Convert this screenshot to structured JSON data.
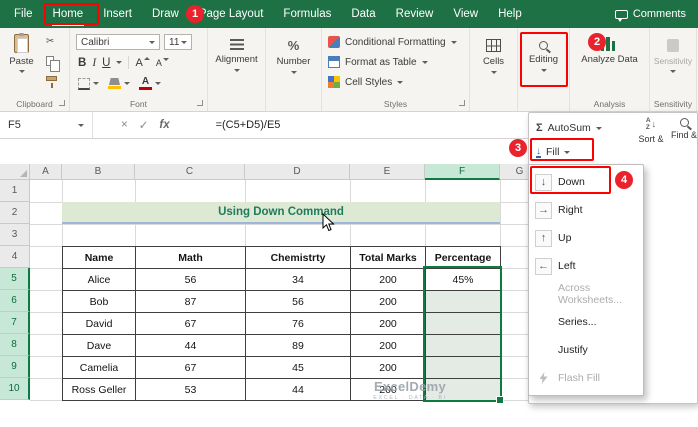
{
  "ribbon_tabs": {
    "items": [
      "File",
      "Home",
      "Insert",
      "Draw",
      "Page Layout",
      "Formulas",
      "Data",
      "Review",
      "View",
      "Help"
    ],
    "comments_label": "Comments"
  },
  "ribbon": {
    "clipboard": {
      "label": "Clipboard",
      "paste": "Paste"
    },
    "font": {
      "label": "Font",
      "family": "Calibri",
      "size": "11",
      "bold": "B",
      "italic": "I",
      "underline": "U",
      "grow": "A",
      "shrink": "A",
      "font_color": "A"
    },
    "alignment": {
      "label": "Alignment"
    },
    "number": {
      "label": "Number"
    },
    "styles": {
      "label": "Styles",
      "conditional_formatting": "Conditional Formatting",
      "format_as_table": "Format as Table",
      "cell_styles": "Cell Styles"
    },
    "cells": {
      "label": "Cells"
    },
    "editing": {
      "label": "Editing"
    },
    "analysis": {
      "label": "Analysis",
      "analyze_data": "Analyze Data"
    },
    "sensitivity": {
      "label": "Sensitivity",
      "button": "Sensitivity"
    }
  },
  "formula_bar": {
    "name_box": "F5",
    "cancel": "×",
    "enter": "✓",
    "fx": "fx",
    "formula": "=(C5+D5)/E5"
  },
  "editing_flyout": {
    "autosum_label": "AutoSum",
    "fill_label": "Fill",
    "sort_label": "Sort &",
    "find_label": "Find &",
    "menu": [
      {
        "label": "Down"
      },
      {
        "label": "Right"
      },
      {
        "label": "Up"
      },
      {
        "label": "Left"
      },
      {
        "label": "Across Worksheets..."
      },
      {
        "label": "Series..."
      },
      {
        "label": "Justify"
      },
      {
        "label": "Flash Fill"
      }
    ]
  },
  "icons": {
    "sigma": "Σ",
    "arrow_down": "↓",
    "arrow_right": "→",
    "arrow_up": "↑",
    "arrow_left": "←",
    "scissors": "✂",
    "percent": "%",
    "sort_a": "A",
    "sort_z": "Z"
  },
  "annotations": {
    "step1": "1",
    "step2": "2",
    "step3": "3",
    "step4": "4"
  },
  "sheet": {
    "col_headers": [
      "A",
      "B",
      "C",
      "D",
      "E",
      "F",
      "G"
    ],
    "row_headers": [
      "1",
      "2",
      "3",
      "4",
      "5",
      "6",
      "7",
      "8",
      "9",
      "10"
    ],
    "title": "Using Down Command",
    "table": {
      "headers": [
        "Name",
        "Math",
        "Chemistrty",
        "Total Marks",
        "Percentage"
      ],
      "rows": [
        [
          "Alice",
          "56",
          "34",
          "200",
          "45%"
        ],
        [
          "Bob",
          "87",
          "56",
          "200",
          ""
        ],
        [
          "David",
          "67",
          "76",
          "200",
          ""
        ],
        [
          "Dave",
          "44",
          "89",
          "200",
          ""
        ],
        [
          "Camelia",
          "67",
          "45",
          "200",
          ""
        ],
        [
          "Ross Geller",
          "53",
          "44",
          "200",
          ""
        ]
      ]
    },
    "watermark": {
      "name": "ExcelDemy",
      "tagline": "EXCEL · DATA · BI"
    }
  }
}
